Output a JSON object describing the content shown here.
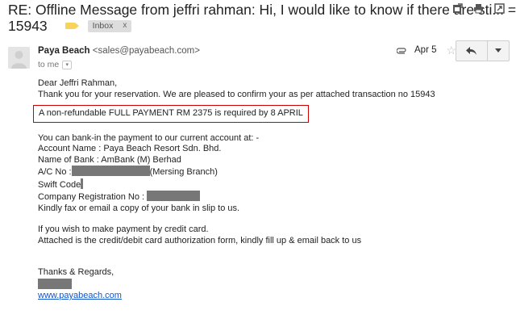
{
  "subject": {
    "line1": "RE: Offline Message from jeffri rahman: Hi, I would like to know if there are sti... =",
    "line2": "15943",
    "label": "Inbox",
    "label_close": "x"
  },
  "toolbar": {
    "icons": [
      "new-window-icon",
      "print-icon",
      "expand-icon"
    ]
  },
  "sender": {
    "name": "Paya Beach",
    "email": "<sales@payabeach.com>",
    "to": "to me",
    "date": "Apr 5",
    "star": "☆"
  },
  "email_body": {
    "greeting": "Dear Jeffri Rahman,",
    "line_thanks": "Thank you for your reservation. We are pleased to confirm your as per attached transaction no 15943",
    "highlight": "A non-refundable FULL PAYMENT RM 2375 is required by 8 APRIL",
    "bank_intro": "You can bank-in the payment to our current account at: -",
    "account_name": "Account Name : Paya Beach Resort Sdn. Bhd.",
    "bank_name": "Name of Bank : AmBank (M) Berhad",
    "ac_no_label": "A/C No :",
    "ac_no_branch": "(Mersing Branch)",
    "swift_label": "Swift Code",
    "company_reg_label": "Company Registration No :",
    "fax_line": "Kindly fax or email a copy of your bank in slip to us.",
    "credit_intro": "If you wish to make payment by credit card.",
    "credit_form": "Attached is the credit/debit card authorization form, kindly fill up & email back to us",
    "regards": "Thanks & Regards,",
    "website": "www.payabeach.com"
  },
  "colors": {
    "highlight_border": "#cc0000",
    "redaction": "#777777",
    "link": "#1155cc",
    "label_tag": "#f7d35a"
  }
}
